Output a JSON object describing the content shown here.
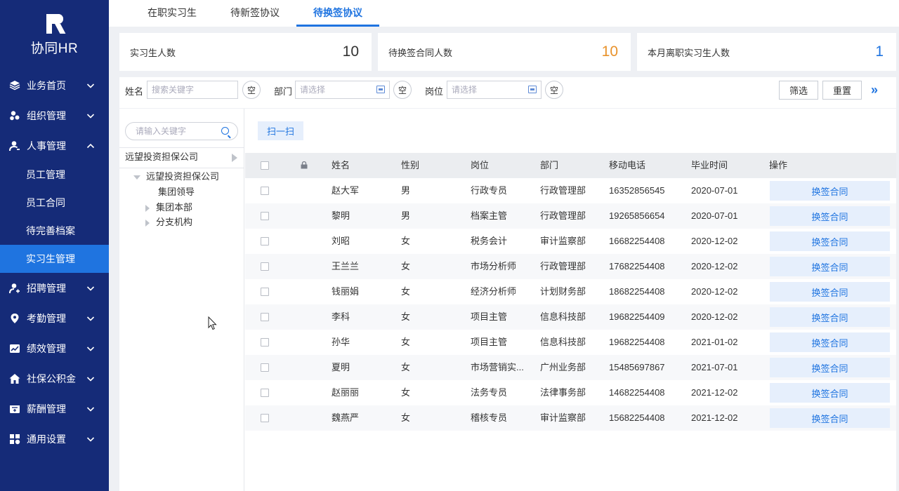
{
  "brand": {
    "name": "协同HR"
  },
  "sidebar": {
    "items": [
      {
        "label": "业务首页",
        "icon": "cube-icon",
        "expanded": false
      },
      {
        "label": "组织管理",
        "icon": "org-icon",
        "expanded": false
      },
      {
        "label": "人事管理",
        "icon": "person-icon",
        "expanded": true,
        "children": [
          "员工管理",
          "员工合同",
          "待完善档案",
          "实习生管理"
        ],
        "active_child": "实习生管理"
      },
      {
        "label": "招聘管理",
        "icon": "person-add-icon",
        "expanded": false
      },
      {
        "label": "考勤管理",
        "icon": "location-icon",
        "expanded": false
      },
      {
        "label": "绩效管理",
        "icon": "chart-icon",
        "expanded": false
      },
      {
        "label": "社保公积金",
        "icon": "home-icon",
        "expanded": false
      },
      {
        "label": "薪酬管理",
        "icon": "wallet-icon",
        "expanded": false
      },
      {
        "label": "通用设置",
        "icon": "grid-icon",
        "expanded": false
      }
    ]
  },
  "tabs": [
    "在职实习生",
    "待新签协议",
    "待换签协议"
  ],
  "active_tab": "待换签协议",
  "stats": [
    {
      "label": "实习生人数",
      "value": "10",
      "color": "#333333"
    },
    {
      "label": "待换签合同人数",
      "value": "10",
      "color": "#e8922b"
    },
    {
      "label": "本月离职实习生人数",
      "value": "1",
      "color": "#1f74e0"
    }
  ],
  "filters": {
    "name_label": "姓名",
    "name_placeholder": "搜索关键字",
    "dept_label": "部门",
    "dept_placeholder": "请选择",
    "post_label": "岗位",
    "post_placeholder": "请选择",
    "clear": "空",
    "filter_btn": "筛选",
    "reset_btn": "重置",
    "more": "»"
  },
  "tree": {
    "search_placeholder": "请输入关键字",
    "root": "远望投资担保公司",
    "nodes": [
      {
        "label": "远望投资担保公司",
        "level": 0,
        "toggle": "down"
      },
      {
        "label": "集团领导",
        "level": 1,
        "toggle": "none"
      },
      {
        "label": "集团本部",
        "level": 1,
        "toggle": "right"
      },
      {
        "label": "分支机构",
        "level": 1,
        "toggle": "right"
      }
    ]
  },
  "scan_btn": "扫一扫",
  "table": {
    "columns": [
      "姓名",
      "性别",
      "岗位",
      "部门",
      "移动电话",
      "毕业时间",
      "操作"
    ],
    "action_label": "换签合同",
    "rows": [
      {
        "name": "赵大军",
        "gender": "男",
        "post": "行政专员",
        "dept": "行政管理部",
        "phone": "16352856545",
        "grad": "2020-07-01"
      },
      {
        "name": "黎明",
        "gender": "男",
        "post": "档案主管",
        "dept": "行政管理部",
        "phone": "19265856654",
        "grad": "2020-07-01"
      },
      {
        "name": "刘昭",
        "gender": "女",
        "post": "税务会计",
        "dept": "审计监察部",
        "phone": "16682254408",
        "grad": "2020-12-02"
      },
      {
        "name": "王兰兰",
        "gender": "女",
        "post": "市场分析师",
        "dept": "行政管理部",
        "phone": "17682254408",
        "grad": "2020-12-02"
      },
      {
        "name": "钱丽娟",
        "gender": "女",
        "post": "经济分析师",
        "dept": "计划财务部",
        "phone": "18682254408",
        "grad": "2020-12-02"
      },
      {
        "name": "李科",
        "gender": "女",
        "post": "项目主管",
        "dept": "信息科技部",
        "phone": "19682254409",
        "grad": "2020-12-02"
      },
      {
        "name": "孙华",
        "gender": "女",
        "post": "项目主管",
        "dept": "信息科技部",
        "phone": "19682254408",
        "grad": "2021-01-02"
      },
      {
        "name": "夏明",
        "gender": "女",
        "post": "市场营销实...",
        "dept": "广州业务部",
        "phone": "15485697867",
        "grad": "2021-07-01"
      },
      {
        "name": "赵丽丽",
        "gender": "女",
        "post": "法务专员",
        "dept": "法律事务部",
        "phone": "14682254408",
        "grad": "2021-12-02"
      },
      {
        "name": "魏燕严",
        "gender": "女",
        "post": "稽核专员",
        "dept": "审计监察部",
        "phone": "15682254408",
        "grad": "2021-12-02"
      }
    ]
  },
  "colors": {
    "sidebar": "#152b78",
    "accent": "#1f74e0",
    "orange": "#e8922b"
  }
}
